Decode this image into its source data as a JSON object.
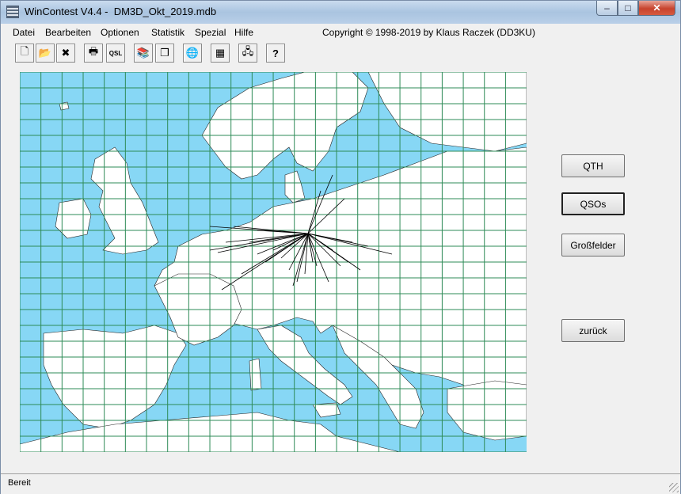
{
  "window": {
    "title": "WinContest V4.4 -  DM3D_Okt_2019.mdb",
    "min_glyph": "–",
    "max_glyph": "□",
    "close_glyph": "✕"
  },
  "menu": {
    "items": [
      "Datei",
      "Bearbeiten",
      "Optionen",
      "Statistik",
      "Spezial",
      "Hilfe"
    ],
    "copyright": "Copyright © 1998-2019 by Klaus Raczek (DD3KU)"
  },
  "toolbar": {
    "buttons": [
      {
        "icon": "new-file-icon",
        "glyph": "🗋"
      },
      {
        "icon": "open-folder-icon",
        "glyph": "📂"
      },
      {
        "icon": "delete-icon",
        "glyph": "✖"
      },
      {
        "icon": "print-icon",
        "glyph": "🖶"
      },
      {
        "icon": "qsl-card-icon",
        "glyph": "QSL"
      },
      {
        "icon": "books-icon",
        "glyph": "📚"
      },
      {
        "icon": "copy-pages-icon",
        "glyph": "❐"
      },
      {
        "icon": "globe-icon",
        "glyph": "🌐"
      },
      {
        "icon": "grid-icon",
        "glyph": "▦"
      },
      {
        "icon": "network-icon",
        "glyph": "🖧"
      },
      {
        "icon": "help-icon",
        "glyph": "?"
      }
    ]
  },
  "map": {
    "sea_color": "#87d7f5",
    "land_color": "#ffffff",
    "grid_color": "#2e8b57",
    "qso_line_color": "#000000",
    "qso_center": "Germany"
  },
  "side_buttons": {
    "qth": "QTH",
    "qsos": "QSOs",
    "grossfelder": "Großfelder",
    "zurueck": "zurück"
  },
  "status": {
    "text": "Bereit"
  }
}
